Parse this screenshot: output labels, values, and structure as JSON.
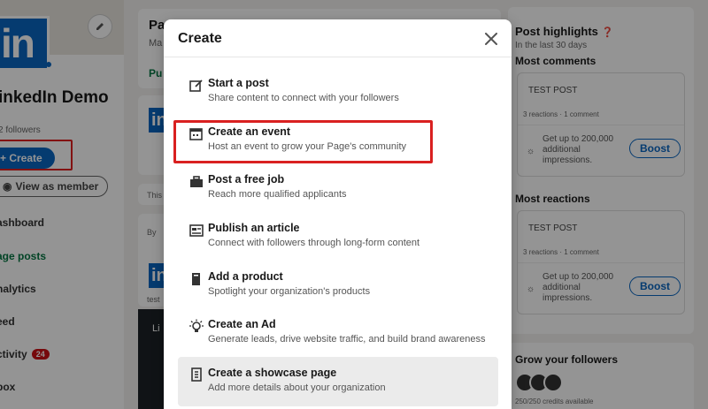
{
  "left_panel": {
    "company_name": "inkedIn Demo",
    "followers": "2 followers",
    "create_label": "+ Create",
    "view_member_label": "View as member",
    "nav": [
      {
        "label": "ashboard"
      },
      {
        "label": "age posts"
      },
      {
        "label": "nalytics"
      },
      {
        "label": "eed"
      },
      {
        "label": "ctivity"
      },
      {
        "label": "box"
      }
    ],
    "activity_badge": "24"
  },
  "middle": {
    "title": "Pa",
    "subtitle": "Ma",
    "tab": "Pu",
    "this_text": "This",
    "by_text": "By",
    "test_text": "test",
    "dark_text": "Li"
  },
  "right_panel": {
    "post_highlights": "Post highlights",
    "last_30": "In the last 30 days",
    "most_comments": "Most comments",
    "most_reactions": "Most reactions",
    "posts": [
      {
        "title": "TEST POST",
        "stats": "3 reactions · 1 comment",
        "boost_text": "Get up to 200,000 additional impressions.",
        "boost_label": "Boost"
      },
      {
        "title": "TEST POST",
        "stats": "3 reactions · 1 comment",
        "boost_text": "Get up to 200,000 additional impressions.",
        "boost_label": "Boost"
      }
    ],
    "grow_followers": "Grow your followers",
    "credits": "250/250 credits available"
  },
  "modal": {
    "title": "Create",
    "options": [
      {
        "icon": "pencil-square-icon",
        "title": "Start a post",
        "desc": "Share content to connect with your followers"
      },
      {
        "icon": "calendar-icon",
        "title": "Create an event",
        "desc": "Host an event to grow your Page's community"
      },
      {
        "icon": "briefcase-icon",
        "title": "Post a free job",
        "desc": "Reach more qualified applicants"
      },
      {
        "icon": "article-icon",
        "title": "Publish an article",
        "desc": "Connect with followers through long-form content"
      },
      {
        "icon": "product-icon",
        "title": "Add a product",
        "desc": "Spotlight your organization's products"
      },
      {
        "icon": "lightbulb-icon",
        "title": "Create an Ad",
        "desc": "Generate leads, drive website traffic, and build brand awareness"
      },
      {
        "icon": "showcase-icon",
        "title": "Create a showcase page",
        "desc": "Add more details about your organization"
      }
    ]
  },
  "colors": {
    "accent": "#0a66c2",
    "highlight": "#d92020",
    "green": "#057642"
  }
}
